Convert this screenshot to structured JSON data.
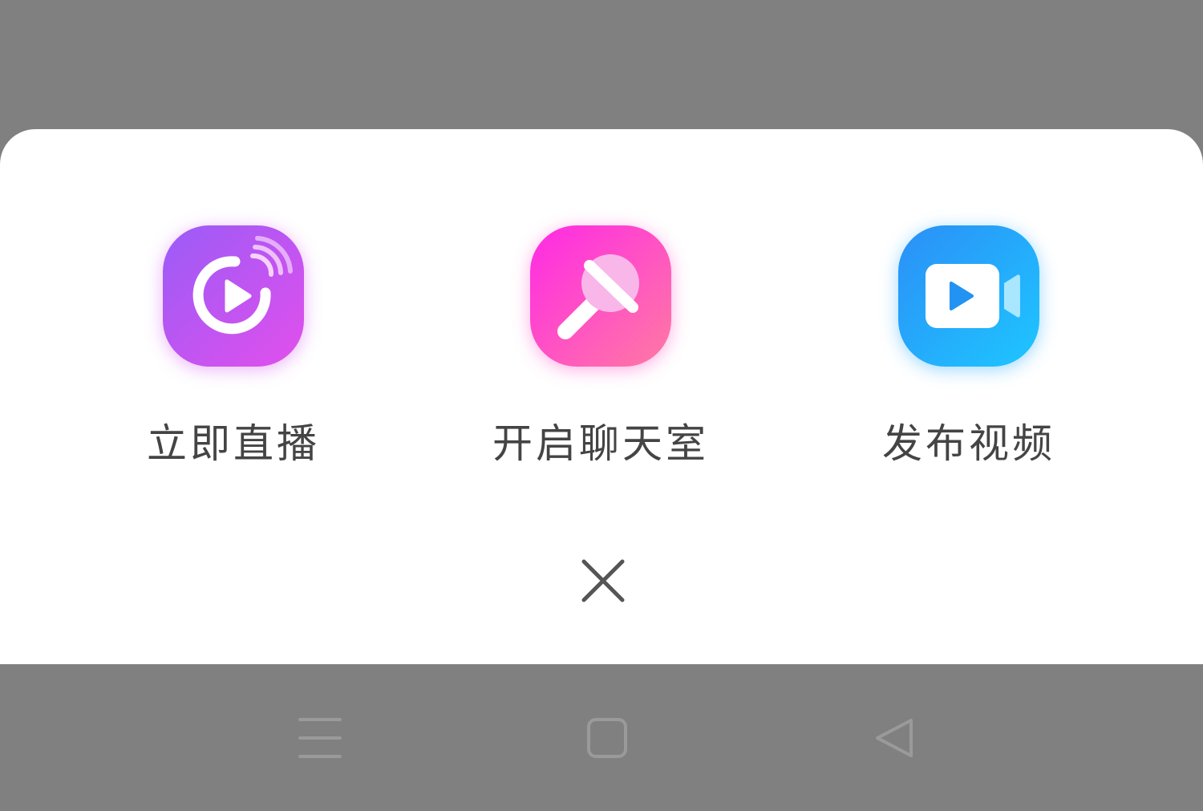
{
  "actions": [
    {
      "label": "立即直播",
      "icon": "live-broadcast-icon",
      "color_from": "#9a5cf7",
      "color_to": "#e24fec"
    },
    {
      "label": "开启聊天室",
      "icon": "microphone-icon",
      "color_from": "#ff29e6",
      "color_to": "#ff7aa2"
    },
    {
      "label": "发布视频",
      "icon": "video-camera-icon",
      "color_from": "#2b8ff7",
      "color_to": "#1ec6ff"
    }
  ],
  "close": {
    "icon": "close-icon"
  },
  "navbar": {
    "icons": [
      "menu-icon",
      "home-icon",
      "back-icon"
    ]
  }
}
